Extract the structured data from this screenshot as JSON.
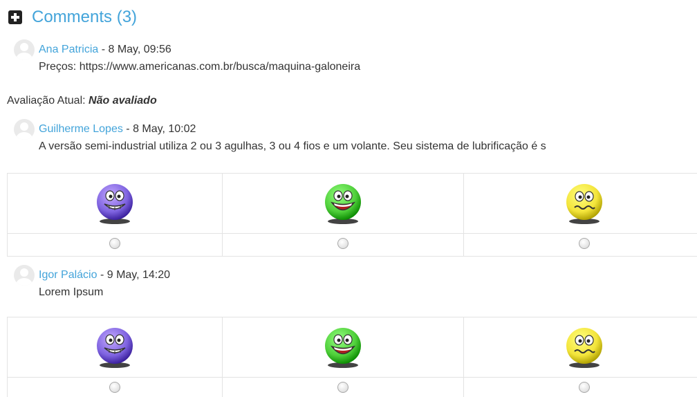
{
  "header": {
    "title": "Comments (3)"
  },
  "comments": [
    {
      "author": "Ana Patricia",
      "meta": " - 8 May, 09:56",
      "text": "Preços: https://www.americanas.com.br/busca/maquina-galoneira"
    },
    {
      "author": "Guilherme Lopes",
      "meta": " - 8 May, 10:02",
      "text": "A versão semi-industrial utiliza 2 ou 3 agulhas, 3 ou 4 fios e um volante. Seu sistema de lubrificação é s"
    },
    {
      "author": "Igor Palácio",
      "meta": " - 9 May, 14:20",
      "text": "Lorem Ipsum"
    }
  ],
  "rating": {
    "label": "Avaliação Atual: ",
    "value": "Não avaliado"
  },
  "vote_options": [
    {
      "icon": "grinning-smiley-icon",
      "color": "#7e63e0"
    },
    {
      "icon": "laughing-smiley-icon",
      "color": "#4fcf3a"
    },
    {
      "icon": "worried-smiley-icon",
      "color": "#f3e43a"
    }
  ]
}
